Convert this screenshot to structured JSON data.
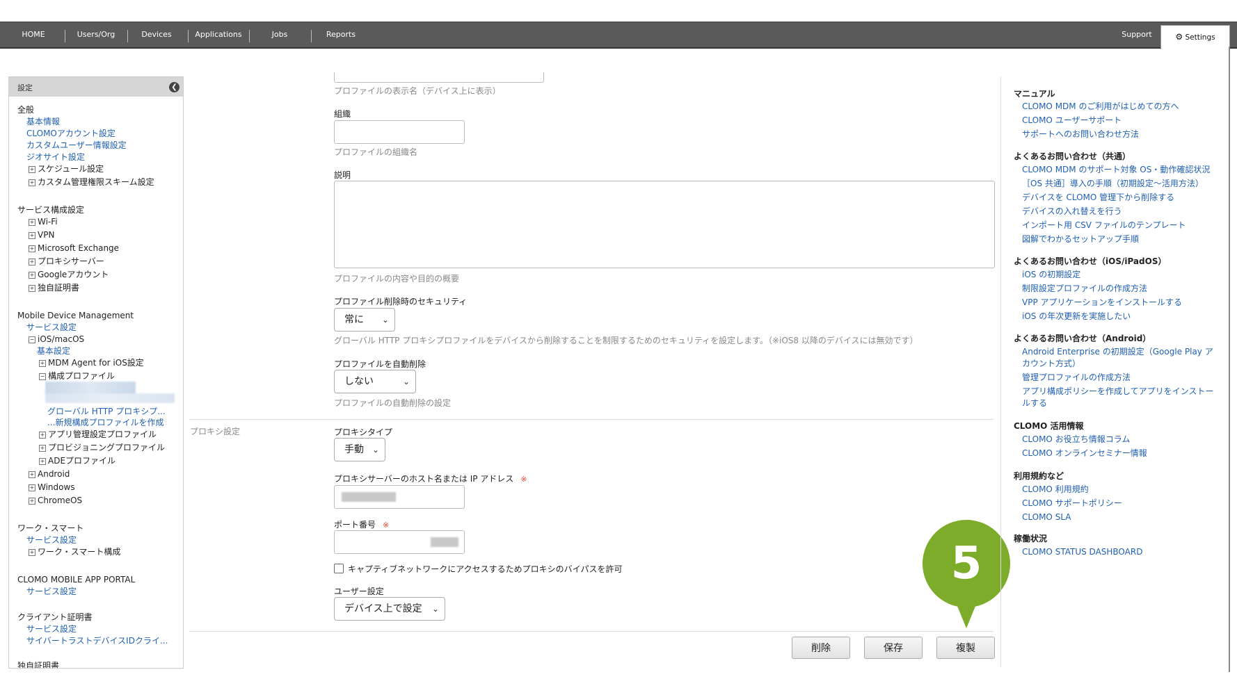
{
  "topnav": {
    "items": [
      "HOME",
      "Users/Org",
      "Devices",
      "Applications",
      "Jobs",
      "Reports"
    ],
    "support": "Support",
    "settings": "Settings"
  },
  "sidebar": {
    "header": "設定",
    "general": {
      "title": "全般",
      "items": [
        "基本情報",
        "CLOMOアカウント設定",
        "カスタムユーザー情報設定",
        "ジオサイト設定"
      ],
      "expandables": [
        "スケジュール設定",
        "カスタム管理権限スキーム設定"
      ]
    },
    "service_config": {
      "title": "サービス構成設定",
      "items": [
        "Wi-Fi",
        "VPN",
        "Microsoft Exchange",
        "プロキシサーバー",
        "Googleアカウント",
        "独自証明書"
      ]
    },
    "mdm": {
      "title": "Mobile Device Management",
      "service_settings": "サービス設定",
      "ios_macos": "iOS/macOS",
      "basic_settings": "基本設定",
      "mdm_agent": "MDM Agent for iOS設定",
      "config_profiles": "構成プロファイル",
      "global_proxy_profile": "グローバル HTTP プロキシプ...",
      "new_config_profile": "...新規構成プロファイルを作成",
      "app_mgmt_profile": "アプリ管理設定プロファイル",
      "provisioning_profile": "プロビジョニングプロファイル",
      "ade_profile": "ADEプロファイル",
      "android": "Android",
      "windows": "Windows",
      "chromeos": "ChromeOS"
    },
    "work_smart": {
      "title": "ワーク・スマート",
      "service_settings": "サービス設定",
      "config": "ワーク・スマート構成"
    },
    "app_portal": {
      "title": "CLOMO MOBILE APP PORTAL",
      "service_settings": "サービス設定"
    },
    "client_cert": {
      "title": "クライアント証明書",
      "service_settings": "サービス設定",
      "cyber_trust": "サイバートラストデバイスIDクライ..."
    },
    "own_cert": {
      "title": "独自証明書"
    }
  },
  "form": {
    "display_name_hint": "プロファイルの表示名（デバイス上に表示）",
    "org_label": "組織",
    "org_value": "",
    "org_hint": "プロファイルの組織名",
    "description_label": "説明",
    "description_value": "",
    "description_hint": "プロファイルの内容や目的の概要",
    "removal_security_label": "プロファイル削除時のセキュリティ",
    "removal_security_value": "常に",
    "removal_security_hint": "グローバル HTTP プロキシプロファイルをデバイスから削除することを制限するためのセキュリティを設定します。（※iOS8 以降のデバイスには無効です）",
    "auto_delete_label": "プロファイルを自動削除",
    "auto_delete_value": "しない",
    "auto_delete_hint": "プロファイルの自動削除の設定",
    "proxy_section_label": "プロキシ設定",
    "proxy_type_label": "プロキシタイプ",
    "proxy_type_value": "手動",
    "proxy_host_label": "プロキシサーバーのホスト名または IP アドレス",
    "port_label": "ポート番号",
    "required_mark": "※",
    "captive_bypass_label": "キャプティブネットワークにアクセスするためプロキシのバイパスを許可",
    "captive_bypass_checked": false,
    "user_setting_label": "ユーザー設定",
    "user_setting_value": "デバイス上で設定"
  },
  "buttons": {
    "delete": "削除",
    "save": "保存",
    "duplicate": "複製"
  },
  "callout": {
    "number": "5",
    "color": "#7dab2a"
  },
  "right_panel": {
    "manual": {
      "title": "マニュアル",
      "links": [
        "CLOMO MDM のご利用がはじめての方へ",
        "CLOMO ユーザーサポート",
        "サポートへのお問い合わせ方法"
      ]
    },
    "faq_common": {
      "title": "よくあるお問い合わせ（共通）",
      "links": [
        "CLOMO MDM のサポート対象 OS・動作確認状況",
        "［OS 共通］導入の手順（初期設定〜活用方法）",
        "デバイスを CLOMO 管理下から削除する",
        "デバイスの入れ替えを行う",
        "インポート用 CSV ファイルのテンプレート",
        "図解でわかるセットアップ手順"
      ]
    },
    "faq_ios": {
      "title": "よくあるお問い合わせ（iOS/iPadOS）",
      "links": [
        "iOS の初期設定",
        "制限設定プロファイルの作成方法",
        "VPP アプリケーションをインストールする",
        "iOS の年次更新を実施したい"
      ]
    },
    "faq_android": {
      "title": "よくあるお問い合わせ（Android）",
      "links": [
        "Android Enterprise の初期設定（Google Play ア",
        "カウント方式）",
        "管理プロファイルの作成方法",
        "アプリ構成ポリシーを作成してアプリをインストー",
        "ルする"
      ]
    },
    "info": {
      "title": "CLOMO 活用情報",
      "links": [
        "CLOMO お役立ち情報コラム",
        "CLOMO オンラインセミナー情報"
      ]
    },
    "terms": {
      "title": "利用規約など",
      "links": [
        "CLOMO 利用規約",
        "CLOMO サポートポリシー",
        "CLOMO SLA"
      ]
    },
    "status": {
      "title": "稼働状況",
      "links": [
        "CLOMO STATUS DASHBOARD"
      ]
    }
  }
}
